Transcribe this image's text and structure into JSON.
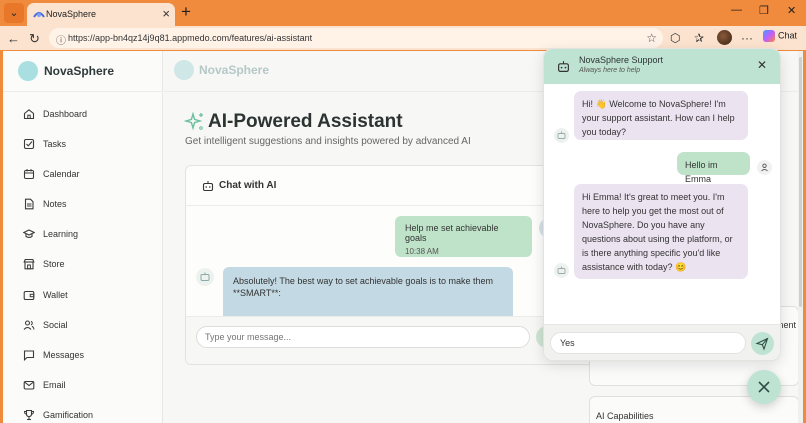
{
  "browser": {
    "tab_title": "NovaSphere",
    "url": "https://app-bn4qz14j9q81.appmedo.com/features/ai-assistant",
    "chat_label": "Chat"
  },
  "sidebar": {
    "brand": "NovaSphere",
    "items": [
      {
        "label": "Dashboard",
        "icon": "home-icon"
      },
      {
        "label": "Tasks",
        "icon": "checkbox-icon"
      },
      {
        "label": "Calendar",
        "icon": "calendar-icon"
      },
      {
        "label": "Notes",
        "icon": "note-icon"
      },
      {
        "label": "Learning",
        "icon": "graduation-cap-icon"
      },
      {
        "label": "Store",
        "icon": "store-icon"
      },
      {
        "label": "Wallet",
        "icon": "wallet-icon"
      },
      {
        "label": "Social",
        "icon": "users-icon"
      },
      {
        "label": "Messages",
        "icon": "message-icon"
      },
      {
        "label": "Email",
        "icon": "mail-icon"
      },
      {
        "label": "Gamification",
        "icon": "trophy-icon"
      }
    ]
  },
  "main": {
    "brand": "NovaSphere",
    "title": "AI-Powered Assistant",
    "subtitle": "Get intelligent suggestions and insights powered by advanced AI",
    "chat_card": {
      "title": "Chat with AI",
      "user_message": "Help me set achievable goals",
      "user_time": "10:38 AM",
      "ai_message": "Absolutely! The best way to set achievable goals is to make them **SMART**:",
      "input_placeholder": "Type your message..."
    },
    "right_card_edge_text": "nent",
    "right_card2_title": "AI Capabilities"
  },
  "support": {
    "title": "NovaSphere Support",
    "subtitle": "Always here to help",
    "messages": [
      {
        "from": "bot",
        "text": "Hi! 👋 Welcome to NovaSphere! I'm your support assistant. How can I help you today?"
      },
      {
        "from": "user",
        "text": "Hello im Emma"
      },
      {
        "from": "bot",
        "text": "Hi Emma! It's great to meet you. I'm here to help you get the most out of NovaSphere. Do you have any questions about using the platform, or is there anything specific you'd like assistance with today? 😊"
      }
    ],
    "input_value": "Yes"
  },
  "colors": {
    "browser_frame": "#f08a3c",
    "accent_mint": "#bfe3d3",
    "user_bubble": "#bfe3c9",
    "ai_bubble": "#c3d9e3",
    "support_bot_bubble": "#ece3f1"
  }
}
